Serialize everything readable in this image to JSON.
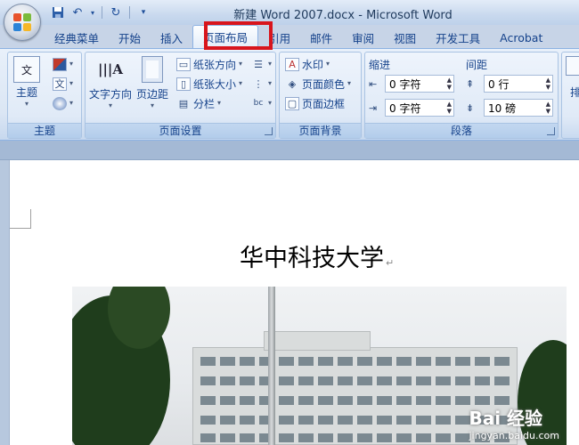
{
  "window": {
    "title": "新建 Word 2007.docx - Microsoft Word"
  },
  "qat": {
    "icons": [
      "save-icon",
      "undo-icon",
      "redo-icon",
      "customize-icon"
    ]
  },
  "tabs": [
    {
      "label": "经典菜单"
    },
    {
      "label": "开始"
    },
    {
      "label": "插入"
    },
    {
      "label": "页面布局",
      "active": true
    },
    {
      "label": "引用"
    },
    {
      "label": "邮件"
    },
    {
      "label": "审阅"
    },
    {
      "label": "视图"
    },
    {
      "label": "开发工具"
    },
    {
      "label": "Acrobat"
    }
  ],
  "groups": {
    "theme": {
      "label": "主题",
      "button": "主题"
    },
    "page_setup": {
      "label": "页面设置",
      "text_direction": "文字方向",
      "margins": "页边距",
      "orientation": "纸张方向",
      "size": "纸张大小",
      "columns": "分栏"
    },
    "page_background": {
      "label": "页面背景",
      "watermark": "水印",
      "page_color": "页面颜色",
      "page_borders": "页面边框"
    },
    "paragraph": {
      "label": "段落",
      "indent_label": "缩进",
      "spacing_label": "间距",
      "indent_left": "0 字符",
      "indent_right": "0 字符",
      "spacing_before": "0 行",
      "spacing_after": "10 磅"
    },
    "arrange": {
      "label": "排"
    }
  },
  "document": {
    "title": "华中科技大学"
  },
  "watermark_text": {
    "brand": "Bai 经验",
    "url": "jingyan.baidu.com"
  },
  "colors": {
    "highlight": "#d8151c",
    "ribbon_text": "#15428b"
  }
}
